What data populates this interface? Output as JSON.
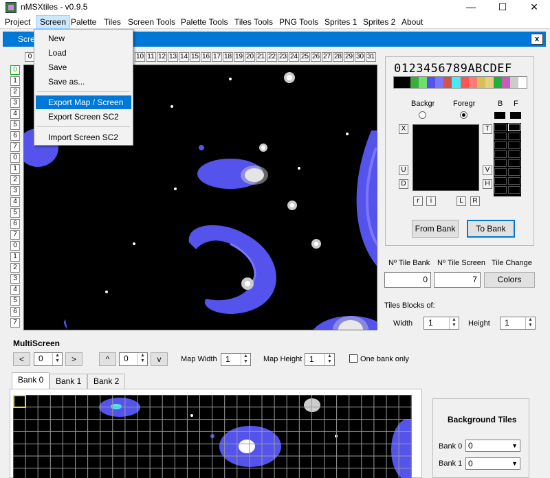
{
  "window": {
    "title": "nMSXtiles - v0.9.5",
    "minimize": "—",
    "maximize": "☐",
    "close": "✕"
  },
  "menubar": [
    "Project",
    "Screen",
    "Palette",
    "Tiles",
    "Screen Tools",
    "Palette Tools",
    "Tiles Tools",
    "PNG Tools",
    "Sprites 1",
    "Sprites 2",
    "About"
  ],
  "header": {
    "label": "Scre",
    "close": "x"
  },
  "screen_menu": {
    "items": [
      "New",
      "Load",
      "Save",
      "Save as...",
      "Export Map / Screen",
      "Export Screen SC2",
      "Import Screen SC2"
    ],
    "highlighted": "Export Map / Screen"
  },
  "column_numbers": [
    "0",
    "10",
    "11",
    "12",
    "13",
    "14",
    "15",
    "16",
    "17",
    "18",
    "19",
    "20",
    "21",
    "22",
    "23",
    "24",
    "25",
    "26",
    "27",
    "28",
    "29",
    "30",
    "31"
  ],
  "row_numbers": [
    "0",
    "1",
    "2",
    "3",
    "4",
    "5",
    "6",
    "7",
    "0",
    "1",
    "2",
    "3",
    "4",
    "5",
    "6",
    "7",
    "0",
    "1",
    "2",
    "3",
    "4",
    "5",
    "6",
    "7"
  ],
  "tile_editor": {
    "hex_digits": "0123456789ABCDEF",
    "palette_colors": [
      "#000000",
      "#000000",
      "#3aad3a",
      "#6ee06e",
      "#5454ed",
      "#7d76fc",
      "#d4524d",
      "#42ebf5",
      "#fc5554",
      "#ff7978",
      "#d4c154",
      "#e6ce80",
      "#21b03b",
      "#c95bba",
      "#cccccc",
      "#ffffff"
    ],
    "backgr_label": "Backgr",
    "foregr_label": "Foregr",
    "b_label": "B",
    "f_label": "F",
    "btn_x": "X",
    "btn_u": "U",
    "btn_d": "D",
    "btn_t": "T",
    "btn_v": "V",
    "btn_h": "H",
    "btn_r": "r",
    "btn_i": "i",
    "btn_l": "L",
    "btn_R": "R",
    "from_bank": "From Bank",
    "to_bank": "To Bank"
  },
  "info": {
    "tile_bank_label": "Nº Tile Bank",
    "tile_screen_label": "Nº Tile Screen",
    "tile_change_label": "Tile Change",
    "tile_bank_value": "0",
    "tile_screen_value": "7",
    "colors_button": "Colors",
    "blocks_label": "Tiles Blocks of:",
    "width_label": "Width",
    "width_value": "1",
    "height_label": "Height",
    "height_value": "1"
  },
  "multiscreen": {
    "title": "MultiScreen",
    "prev": "<",
    "h_value": "0",
    "next": ">",
    "up": "^",
    "v_value": "0",
    "down": "v",
    "map_width_label": "Map Width",
    "map_width_value": "1",
    "map_height_label": "Map Height",
    "map_height_value": "1",
    "one_bank_label": "One bank only"
  },
  "banks": {
    "tabs": [
      "Bank 0",
      "Bank 1",
      "Bank 2"
    ],
    "active_tab": "Bank 0"
  },
  "background_tiles": {
    "title": "Background Tiles",
    "bank0_label": "Bank 0",
    "bank0_value": "0",
    "bank1_label": "Bank 1",
    "bank1_value": "0"
  }
}
